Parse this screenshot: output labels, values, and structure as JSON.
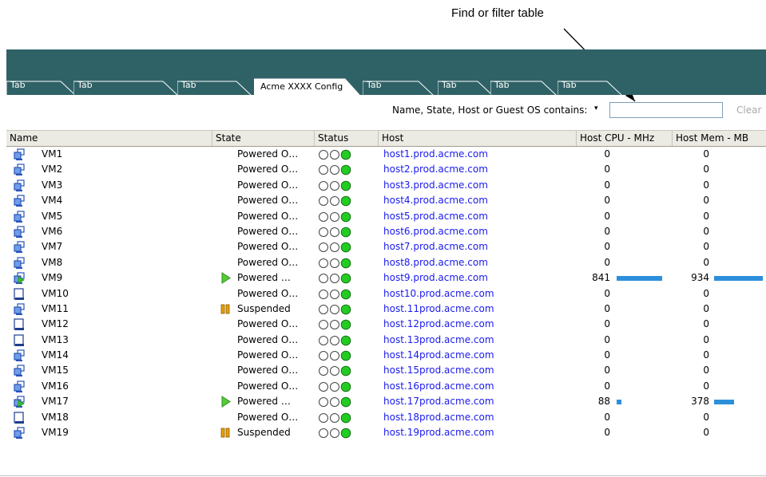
{
  "annotation": {
    "callout": "Find or filter table"
  },
  "tabs": [
    {
      "label": "Tab",
      "active": false
    },
    {
      "label": "Tab",
      "active": false
    },
    {
      "label": "Tab",
      "active": false
    },
    {
      "label": "Acme XXXX Config",
      "active": true
    },
    {
      "label": "Tab",
      "active": false
    },
    {
      "label": "Tab",
      "active": false
    },
    {
      "label": "Tab",
      "active": false
    },
    {
      "label": "Tab",
      "active": false
    }
  ],
  "filter": {
    "label": "Name, State, Host or Guest OS contains:",
    "caret": "▾",
    "value": "",
    "placeholder": "",
    "clear_label": "Clear"
  },
  "table": {
    "columns": {
      "name": "Name",
      "state": "State",
      "status": "Status",
      "host": "Host",
      "cpu": "Host CPU - MHz",
      "mem": "Host Mem - MB"
    },
    "rows": [
      {
        "icon": "vm-icon",
        "name": "VM1",
        "state_icon": "",
        "state": "Powered O…",
        "status": "green",
        "host": "host1.prod.acme.com",
        "cpu": "0",
        "mem": "0"
      },
      {
        "icon": "vm-icon",
        "name": "VM2",
        "state_icon": "",
        "state": "Powered O…",
        "status": "green",
        "host": "host2.prod.acme.com",
        "cpu": "0",
        "mem": "0"
      },
      {
        "icon": "vm-icon",
        "name": "VM3",
        "state_icon": "",
        "state": "Powered O…",
        "status": "green",
        "host": "host3.prod.acme.com",
        "cpu": "0",
        "mem": "0"
      },
      {
        "icon": "vm-icon",
        "name": "VM4",
        "state_icon": "",
        "state": "Powered O…",
        "status": "green",
        "host": "host4.prod.acme.com",
        "cpu": "0",
        "mem": "0"
      },
      {
        "icon": "vm-icon",
        "name": "VM5",
        "state_icon": "",
        "state": "Powered O…",
        "status": "green",
        "host": "host5.prod.acme.com",
        "cpu": "0",
        "mem": "0"
      },
      {
        "icon": "vm-icon",
        "name": "VM6",
        "state_icon": "",
        "state": "Powered O…",
        "status": "green",
        "host": "host6.prod.acme.com",
        "cpu": "0",
        "mem": "0"
      },
      {
        "icon": "vm-icon",
        "name": "VM7",
        "state_icon": "",
        "state": "Powered O…",
        "status": "green",
        "host": "host7.prod.acme.com",
        "cpu": "0",
        "mem": "0"
      },
      {
        "icon": "vm-icon",
        "name": "VM8",
        "state_icon": "",
        "state": "Powered O…",
        "status": "green",
        "host": "host8.prod.acme.com",
        "cpu": "0",
        "mem": "0"
      },
      {
        "icon": "vm-running-icon",
        "name": "VM9",
        "state_icon": "play-icon",
        "state": "Powered …",
        "status": "green",
        "host": "host9.prod.acme.com",
        "cpu": "841",
        "mem": "934",
        "cpu_bar": 0.84,
        "mem_bar": 0.93
      },
      {
        "icon": "template-icon",
        "name": "VM10",
        "state_icon": "",
        "state": "Powered O…",
        "status": "green",
        "host": "host10.prod.acme.com",
        "cpu": "0",
        "mem": "0"
      },
      {
        "icon": "vm-icon",
        "name": "VM11",
        "state_icon": "pause-icon",
        "state": "Suspended",
        "status": "green",
        "host": "host.11prod.acme.com",
        "cpu": "0",
        "mem": "0"
      },
      {
        "icon": "template-icon",
        "name": "VM12",
        "state_icon": "",
        "state": "Powered O…",
        "status": "green",
        "host": "host.12prod.acme.com",
        "cpu": "0",
        "mem": "0"
      },
      {
        "icon": "template-icon",
        "name": "VM13",
        "state_icon": "",
        "state": "Powered O…",
        "status": "green",
        "host": "host.13prod.acme.com",
        "cpu": "0",
        "mem": "0"
      },
      {
        "icon": "vm-icon",
        "name": "VM14",
        "state_icon": "",
        "state": "Powered O…",
        "status": "green",
        "host": "host.14prod.acme.com",
        "cpu": "0",
        "mem": "0"
      },
      {
        "icon": "vm-icon",
        "name": "VM15",
        "state_icon": "",
        "state": "Powered O…",
        "status": "green",
        "host": "host.15prod.acme.com",
        "cpu": "0",
        "mem": "0"
      },
      {
        "icon": "vm-icon",
        "name": "VM16",
        "state_icon": "",
        "state": "Powered O…",
        "status": "green",
        "host": "host.16prod.acme.com",
        "cpu": "0",
        "mem": "0"
      },
      {
        "icon": "vm-running-icon",
        "name": "VM17",
        "state_icon": "play-icon",
        "state": "Powered …",
        "status": "green",
        "host": "host.17prod.acme.com",
        "cpu": "88",
        "mem": "378",
        "cpu_bar": 0.09,
        "mem_bar": 0.38
      },
      {
        "icon": "template-icon",
        "name": "VM18",
        "state_icon": "",
        "state": "Powered O…",
        "status": "green",
        "host": "host.18prod.acme.com",
        "cpu": "0",
        "mem": "0"
      },
      {
        "icon": "vm-icon",
        "name": "VM19",
        "state_icon": "pause-icon",
        "state": "Suspended",
        "status": "green",
        "host": "host.19prod.acme.com",
        "cpu": "0",
        "mem": "0"
      }
    ]
  },
  "colors": {
    "tab_band": "#2f6266",
    "link": "#1a1aee",
    "status_green": "#22cc22",
    "usage_bar": "#2d8fdc",
    "play": "#55cc33",
    "pause": "#e8a000"
  }
}
